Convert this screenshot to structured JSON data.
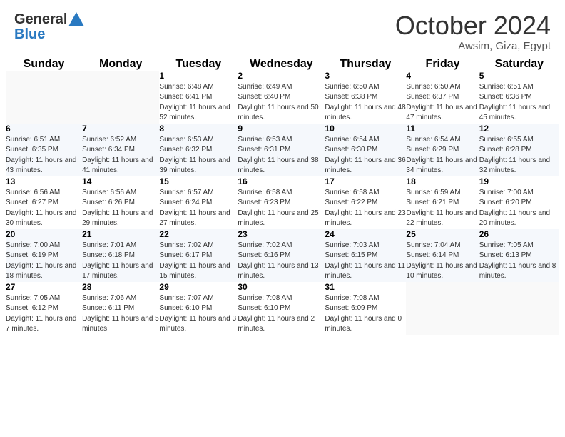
{
  "header": {
    "logo_line1": "General",
    "logo_line2": "Blue",
    "month_title": "October 2024",
    "location": "Awsim, Giza, Egypt"
  },
  "weekdays": [
    "Sunday",
    "Monday",
    "Tuesday",
    "Wednesday",
    "Thursday",
    "Friday",
    "Saturday"
  ],
  "weeks": [
    [
      {
        "day": "",
        "info": ""
      },
      {
        "day": "",
        "info": ""
      },
      {
        "day": "1",
        "info": "Sunrise: 6:48 AM\nSunset: 6:41 PM\nDaylight: 11 hours and 52 minutes."
      },
      {
        "day": "2",
        "info": "Sunrise: 6:49 AM\nSunset: 6:40 PM\nDaylight: 11 hours and 50 minutes."
      },
      {
        "day": "3",
        "info": "Sunrise: 6:50 AM\nSunset: 6:38 PM\nDaylight: 11 hours and 48 minutes."
      },
      {
        "day": "4",
        "info": "Sunrise: 6:50 AM\nSunset: 6:37 PM\nDaylight: 11 hours and 47 minutes."
      },
      {
        "day": "5",
        "info": "Sunrise: 6:51 AM\nSunset: 6:36 PM\nDaylight: 11 hours and 45 minutes."
      }
    ],
    [
      {
        "day": "6",
        "info": "Sunrise: 6:51 AM\nSunset: 6:35 PM\nDaylight: 11 hours and 43 minutes."
      },
      {
        "day": "7",
        "info": "Sunrise: 6:52 AM\nSunset: 6:34 PM\nDaylight: 11 hours and 41 minutes."
      },
      {
        "day": "8",
        "info": "Sunrise: 6:53 AM\nSunset: 6:32 PM\nDaylight: 11 hours and 39 minutes."
      },
      {
        "day": "9",
        "info": "Sunrise: 6:53 AM\nSunset: 6:31 PM\nDaylight: 11 hours and 38 minutes."
      },
      {
        "day": "10",
        "info": "Sunrise: 6:54 AM\nSunset: 6:30 PM\nDaylight: 11 hours and 36 minutes."
      },
      {
        "day": "11",
        "info": "Sunrise: 6:54 AM\nSunset: 6:29 PM\nDaylight: 11 hours and 34 minutes."
      },
      {
        "day": "12",
        "info": "Sunrise: 6:55 AM\nSunset: 6:28 PM\nDaylight: 11 hours and 32 minutes."
      }
    ],
    [
      {
        "day": "13",
        "info": "Sunrise: 6:56 AM\nSunset: 6:27 PM\nDaylight: 11 hours and 30 minutes."
      },
      {
        "day": "14",
        "info": "Sunrise: 6:56 AM\nSunset: 6:26 PM\nDaylight: 11 hours and 29 minutes."
      },
      {
        "day": "15",
        "info": "Sunrise: 6:57 AM\nSunset: 6:24 PM\nDaylight: 11 hours and 27 minutes."
      },
      {
        "day": "16",
        "info": "Sunrise: 6:58 AM\nSunset: 6:23 PM\nDaylight: 11 hours and 25 minutes."
      },
      {
        "day": "17",
        "info": "Sunrise: 6:58 AM\nSunset: 6:22 PM\nDaylight: 11 hours and 23 minutes."
      },
      {
        "day": "18",
        "info": "Sunrise: 6:59 AM\nSunset: 6:21 PM\nDaylight: 11 hours and 22 minutes."
      },
      {
        "day": "19",
        "info": "Sunrise: 7:00 AM\nSunset: 6:20 PM\nDaylight: 11 hours and 20 minutes."
      }
    ],
    [
      {
        "day": "20",
        "info": "Sunrise: 7:00 AM\nSunset: 6:19 PM\nDaylight: 11 hours and 18 minutes."
      },
      {
        "day": "21",
        "info": "Sunrise: 7:01 AM\nSunset: 6:18 PM\nDaylight: 11 hours and 17 minutes."
      },
      {
        "day": "22",
        "info": "Sunrise: 7:02 AM\nSunset: 6:17 PM\nDaylight: 11 hours and 15 minutes."
      },
      {
        "day": "23",
        "info": "Sunrise: 7:02 AM\nSunset: 6:16 PM\nDaylight: 11 hours and 13 minutes."
      },
      {
        "day": "24",
        "info": "Sunrise: 7:03 AM\nSunset: 6:15 PM\nDaylight: 11 hours and 11 minutes."
      },
      {
        "day": "25",
        "info": "Sunrise: 7:04 AM\nSunset: 6:14 PM\nDaylight: 11 hours and 10 minutes."
      },
      {
        "day": "26",
        "info": "Sunrise: 7:05 AM\nSunset: 6:13 PM\nDaylight: 11 hours and 8 minutes."
      }
    ],
    [
      {
        "day": "27",
        "info": "Sunrise: 7:05 AM\nSunset: 6:12 PM\nDaylight: 11 hours and 7 minutes."
      },
      {
        "day": "28",
        "info": "Sunrise: 7:06 AM\nSunset: 6:11 PM\nDaylight: 11 hours and 5 minutes."
      },
      {
        "day": "29",
        "info": "Sunrise: 7:07 AM\nSunset: 6:10 PM\nDaylight: 11 hours and 3 minutes."
      },
      {
        "day": "30",
        "info": "Sunrise: 7:08 AM\nSunset: 6:10 PM\nDaylight: 11 hours and 2 minutes."
      },
      {
        "day": "31",
        "info": "Sunrise: 7:08 AM\nSunset: 6:09 PM\nDaylight: 11 hours and 0 minutes."
      },
      {
        "day": "",
        "info": ""
      },
      {
        "day": "",
        "info": ""
      }
    ]
  ]
}
